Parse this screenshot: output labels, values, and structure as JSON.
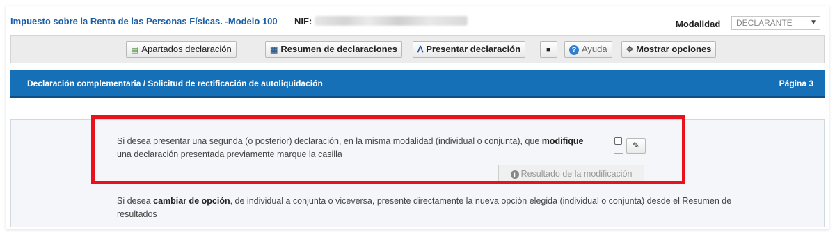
{
  "header": {
    "title": "Impuesto sobre la Renta de las Personas Físicas. -Modelo 100",
    "nif_label": "NIF:",
    "modalidad_label": "Modalidad",
    "modalidad_value": "DECLARANTE"
  },
  "toolbar": {
    "apartados": "Apartados declaración",
    "resumen": "Resumen de declaraciones",
    "presentar": "Presentar declaración",
    "ayuda": "Ayuda",
    "mostrar": "Mostrar opciones"
  },
  "section": {
    "title": "Declaración complementaria / Solicitud de rectificación de autoliquidación",
    "page": "Página 3"
  },
  "content": {
    "p1_part1": "Si desea presentar una segunda (o posterior) declaración, en la misma modalidad (individual o conjunta), que",
    "p1_bold": "modifique",
    "p1_part2": "una declaración presentada previamente marque la casilla",
    "checkbox_checked": false,
    "result_button": "Resultado de la modificación",
    "p2_part1": "Si desea",
    "p2_bold": "cambiar de opción",
    "p2_part2": ", de individual a conjunta o viceversa, presente directamente la nueva opción elegida (individual o conjunta) desde el Resumen de resultados"
  },
  "icons": {
    "apartados": "list-form-icon",
    "resumen": "summary-icon",
    "presentar": "submit-icon",
    "camera": "camera-icon",
    "ayuda": "help-icon",
    "mostrar": "options-icon",
    "edit": "pencil-icon",
    "info": "info-icon"
  },
  "colors": {
    "title_blue": "#1a5ea8",
    "bar_blue": "#1670b8",
    "highlight_red": "#e8121c"
  }
}
